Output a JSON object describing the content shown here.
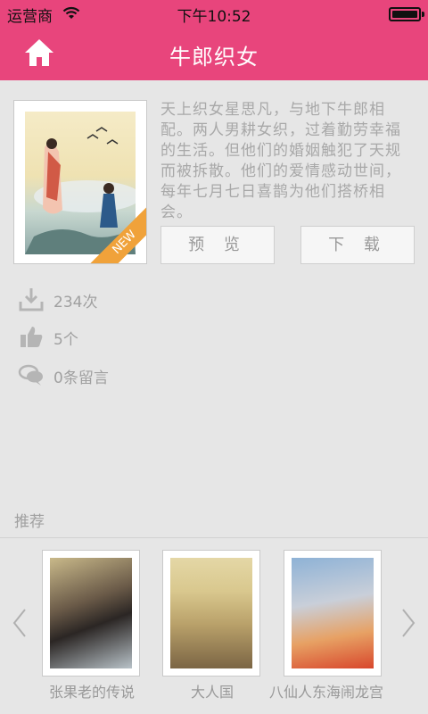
{
  "status_bar": {
    "carrier": "运营商",
    "time": "下午10:52"
  },
  "header": {
    "title": "牛郎织女",
    "home_icon": "home-icon",
    "color": "#e8457c"
  },
  "book": {
    "badge": "NEW",
    "description": "天上织女星思凡，与地下牛郎相配。两人男耕女织，过着勤劳幸福的生活。但他们的婚姻触犯了天规而被拆散。他们的爱情感动世间，每年七月七日喜鹊为他们搭桥相会。",
    "preview_label": "预 览",
    "download_label": "下 载"
  },
  "stats": {
    "downloads": "234次",
    "likes": "5个",
    "comments": "0条留言"
  },
  "recommend": {
    "title": "推荐",
    "items": [
      {
        "title": "张果老的传说"
      },
      {
        "title": "大人国"
      },
      {
        "title": "八仙人东海闹龙宫"
      }
    ]
  }
}
